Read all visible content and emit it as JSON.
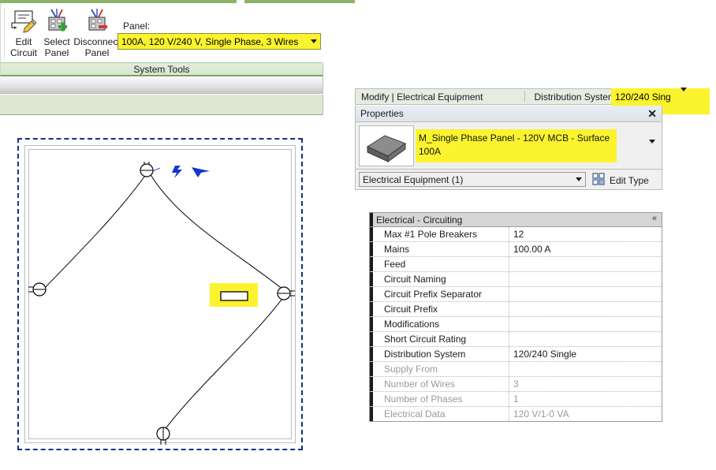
{
  "ribbon": {
    "buttons": [
      {
        "label": "Edit\nCircuit",
        "icon": "edit-circuit-icon"
      },
      {
        "label": "Select\nPanel",
        "icon": "select-panel-icon"
      },
      {
        "label": "Disconnect\nPanel",
        "icon": "disconnect-panel-icon"
      }
    ],
    "panel_field_label": "Panel:",
    "panel_value": "100A, 120 V/240 V, Single Phase, 3 Wires",
    "group_title": "System Tools",
    "highlight_color": "#fbf32e"
  },
  "options_bar": {
    "context_label": "Modify | Electrical Equipment",
    "distribution_label": "Distribution System:",
    "distribution_value": "120/240 Sing"
  },
  "properties": {
    "title": "Properties",
    "close_label": "✕",
    "type_name": "M_Single Phase Panel - 120V MCB - Surface 100A",
    "instance_selector": "Electrical Equipment (1)",
    "edit_type_label": "Edit Type",
    "group_header": "Electrical - Circuiting",
    "group_chevron": "«",
    "rows": [
      {
        "name": "Max #1 Pole Breakers",
        "value": "12",
        "dim": false
      },
      {
        "name": "Mains",
        "value": "100.00 A",
        "dim": false
      },
      {
        "name": "Feed",
        "value": "",
        "dim": false
      },
      {
        "name": "Circuit Naming",
        "value": "",
        "dim": false
      },
      {
        "name": "Circuit Prefix Separator",
        "value": "",
        "dim": false
      },
      {
        "name": "Circuit Prefix",
        "value": "",
        "dim": false
      },
      {
        "name": "Modifications",
        "value": "",
        "dim": false
      },
      {
        "name": "Short Circuit Rating",
        "value": "",
        "dim": false
      },
      {
        "name": "Distribution System",
        "value": "120/240 Single",
        "dim": false
      },
      {
        "name": "Supply From",
        "value": "",
        "dim": true
      },
      {
        "name": "Number of Wires",
        "value": "3",
        "dim": true
      },
      {
        "name": "Number of Phases",
        "value": "1",
        "dim": true
      },
      {
        "name": "Electrical Data",
        "value": "120 V/1-0 VA",
        "dim": true
      }
    ]
  },
  "canvas": {
    "selection_color": "#14308c",
    "wire_color": "#000000",
    "panel_highlight_color": "#fbf32e",
    "annotation_icons": [
      "lightning-bolt-icon",
      "cursor-arrow-icon"
    ],
    "device_symbols": [
      "receptacle-top",
      "receptacle-left",
      "receptacle-right",
      "receptacle-bottom"
    ]
  }
}
